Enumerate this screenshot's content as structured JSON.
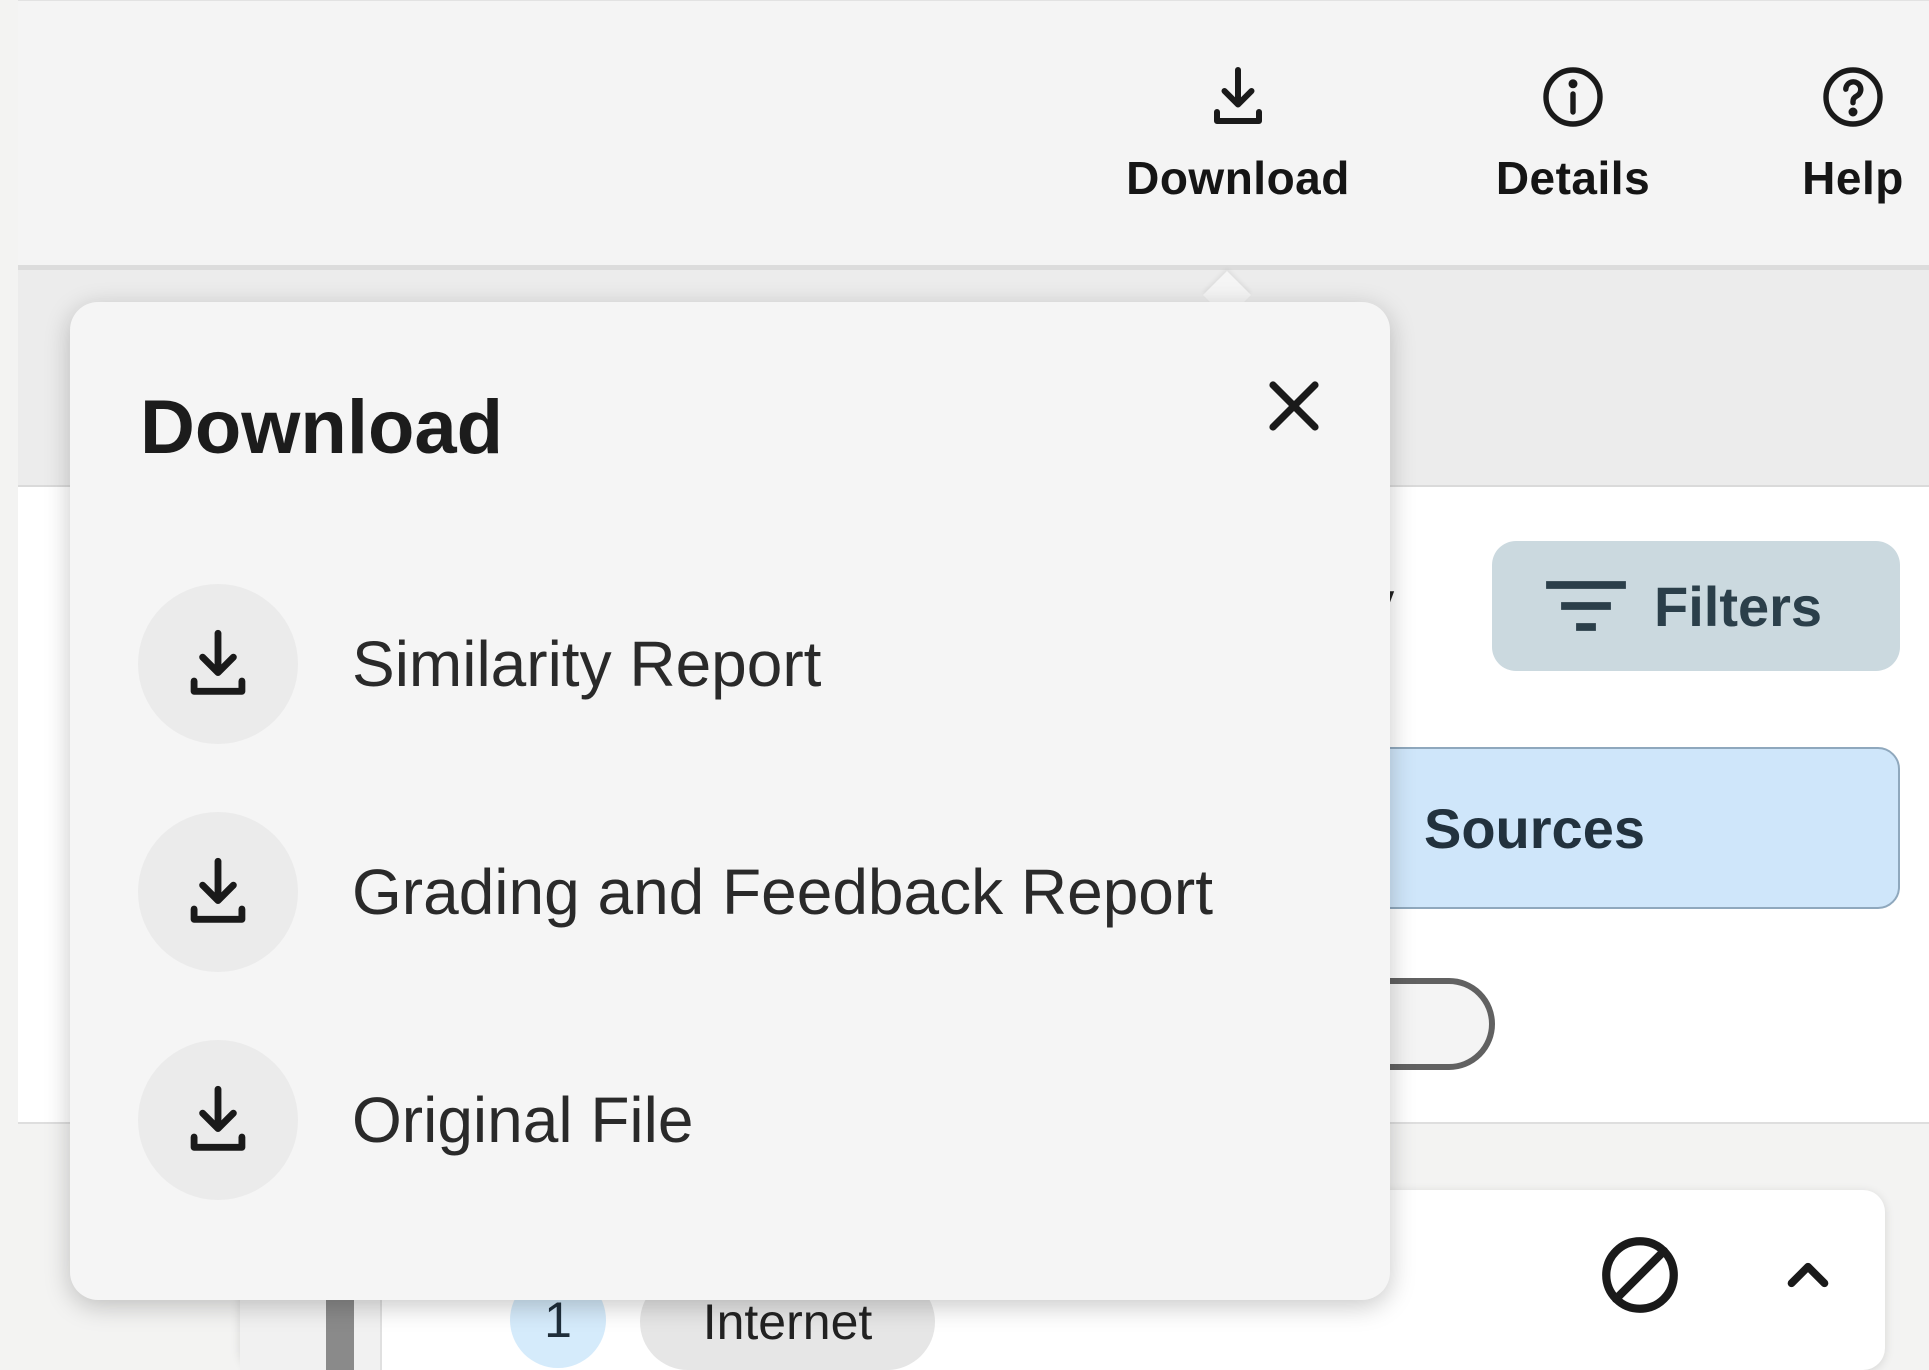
{
  "toolbar": {
    "download_label": "Download",
    "details_label": "Details",
    "help_label": "Help"
  },
  "background": {
    "title_fragment": "y",
    "filters_label": "Filters",
    "sources_tab_label": "Sources",
    "source_card": {
      "number": "1",
      "type_label": "Internet"
    }
  },
  "download_popover": {
    "title": "Download",
    "options": [
      {
        "label": "Similarity Report",
        "icon": "download-icon"
      },
      {
        "label": "Grading and Feedback Report",
        "icon": "download-icon"
      },
      {
        "label": "Original File",
        "icon": "download-icon"
      }
    ]
  },
  "colors": {
    "filters_bg": "#cbd9df",
    "sources_tab_bg": "#cfe6fa",
    "popover_bg": "#f5f5f5",
    "option_icon_bg": "#ebebeb"
  }
}
